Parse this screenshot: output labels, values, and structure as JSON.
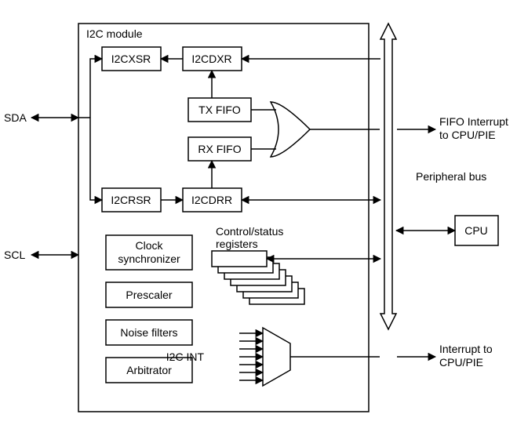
{
  "module_title": "I2C module",
  "left_pins": {
    "sda": "SDA",
    "scl": "SCL"
  },
  "top_row": {
    "i2cxsr": "I2CXSR",
    "i2cdxr": "I2CDXR"
  },
  "fifo": {
    "tx": "TX FIFO",
    "rx": "RX FIFO"
  },
  "mid_row": {
    "i2crsr": "I2CRSR",
    "i2cdrr": "I2CDRR"
  },
  "left_blocks": {
    "clock_sync_l1": "Clock",
    "clock_sync_l2": "synchronizer",
    "prescaler": "Prescaler",
    "noise": "Noise filters",
    "arbitrator": "Arbitrator"
  },
  "ctrl_reg_l1": "Control/status",
  "ctrl_reg_l2": "registers",
  "i2c_int": "I2C INT",
  "bus_label": "Peripheral bus",
  "cpu": "CPU",
  "fifo_int_l1": "FIFO Interrupt",
  "fifo_int_l2": "to CPU/PIE",
  "int_l1": "Interrupt to",
  "int_l2": "CPU/PIE"
}
